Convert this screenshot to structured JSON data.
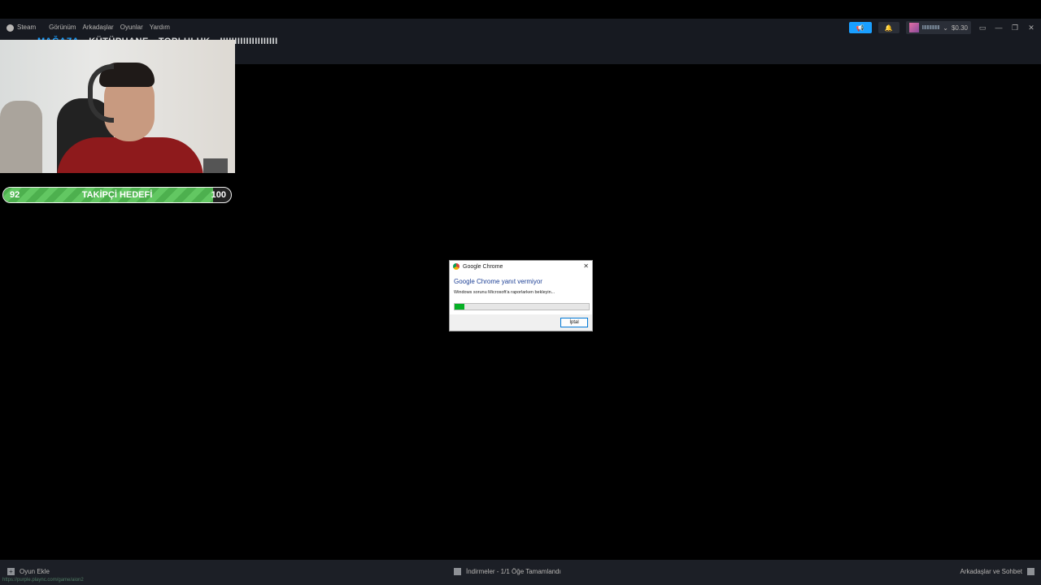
{
  "menu": {
    "app": "Steam",
    "items": [
      "Görünüm",
      "Arkadaşlar",
      "Oyunlar",
      "Yardım"
    ]
  },
  "account": {
    "name": "IIIIIIIIIIIIIII",
    "balance": "$0.30"
  },
  "nav": {
    "store": "MAĞAZA",
    "library": "KÜTÜPHANE",
    "community": "TOPLULUK",
    "username": "IIIIIIIIIIIIIIIIIIII"
  },
  "goal": {
    "start": "92",
    "title": "TAKİPÇİ HEDEFİ",
    "end": "100",
    "progress_fraction": 0.92
  },
  "dialog": {
    "title": "Google Chrome",
    "heading": "Google Chrome yanıt vermiyor",
    "message": "Windows sorunu Microsoft'a raporlarken bekleyin...",
    "progress_fraction": 0.07,
    "cancel": "İptal"
  },
  "bottom": {
    "add_game": "Oyun Ekle",
    "url": "https://purple.plaync.com/game/aion2",
    "downloads": "İndirmeler - 1/1 Öğe Tamamlandı",
    "friends": "Arkadaşlar ve Sohbet"
  },
  "colors": {
    "accent": "#1a9fff",
    "goal_green": "#4db04e",
    "dialog_progress": "#06b025"
  }
}
